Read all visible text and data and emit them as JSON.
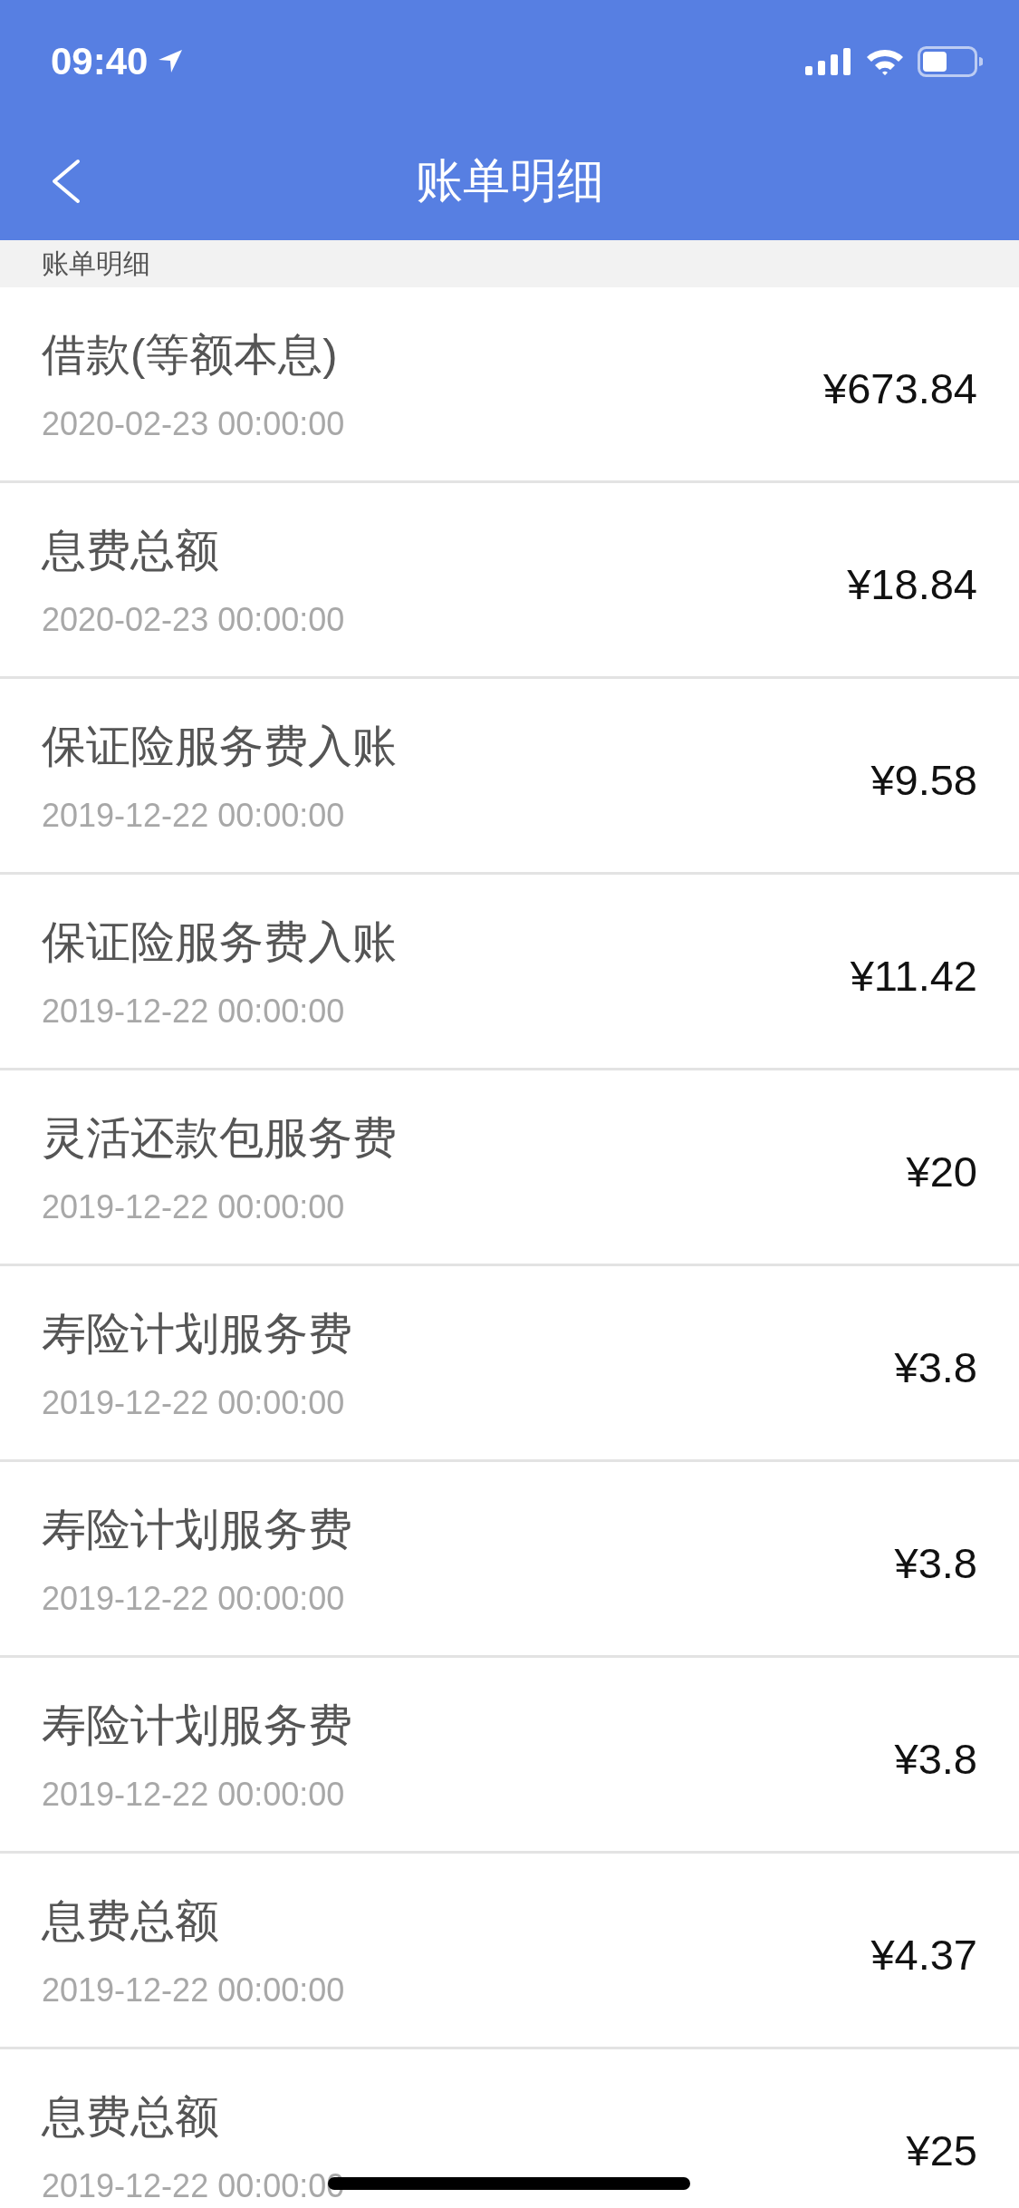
{
  "status_bar": {
    "time": "09:40"
  },
  "nav_bar": {
    "title": "账单明细"
  },
  "section_header": "账单明细",
  "bills": [
    {
      "name": "借款(等额本息)",
      "time": "2020-02-23 00:00:00",
      "amount": "¥673.84"
    },
    {
      "name": "息费总额",
      "time": "2020-02-23 00:00:00",
      "amount": "¥18.84"
    },
    {
      "name": "保证险服务费入账",
      "time": "2019-12-22 00:00:00",
      "amount": "¥9.58"
    },
    {
      "name": "保证险服务费入账",
      "time": "2019-12-22 00:00:00",
      "amount": "¥11.42"
    },
    {
      "name": "灵活还款包服务费",
      "time": "2019-12-22 00:00:00",
      "amount": "¥20"
    },
    {
      "name": "寿险计划服务费",
      "time": "2019-12-22 00:00:00",
      "amount": "¥3.8"
    },
    {
      "name": "寿险计划服务费",
      "time": "2019-12-22 00:00:00",
      "amount": "¥3.8"
    },
    {
      "name": "寿险计划服务费",
      "time": "2019-12-22 00:00:00",
      "amount": "¥3.8"
    },
    {
      "name": "息费总额",
      "time": "2019-12-22 00:00:00",
      "amount": "¥4.37"
    },
    {
      "name": "息费总额",
      "time": "2019-12-22 00:00:00",
      "amount": "¥25"
    }
  ]
}
